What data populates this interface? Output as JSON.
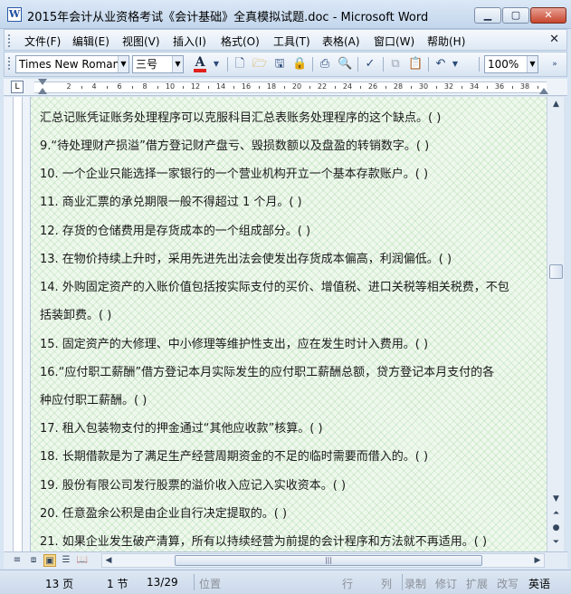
{
  "window": {
    "title": "2015年会计从业资格考试《会计基础》全真模拟试题.doc - Microsoft Word",
    "app_icon_letter": "W",
    "buttons": [
      "minimize-icon",
      "maximize-icon",
      "close-icon"
    ]
  },
  "menu": {
    "items": [
      "文件(F)",
      "编辑(E)",
      "视图(V)",
      "插入(I)",
      "格式(O)",
      "工具(T)",
      "表格(A)",
      "窗口(W)",
      "帮助(H)"
    ],
    "close_glyph": "✕"
  },
  "toolbar": {
    "font_name": "Times New Roman",
    "font_size": "三号",
    "font_color_letter": "A",
    "font_color": "#e0211c",
    "zoom": "100%"
  },
  "ruler": {
    "labels": [
      "2",
      "4",
      "6",
      "8",
      "10",
      "12",
      "14",
      "16",
      "18",
      "20",
      "22",
      "24",
      "26",
      "28",
      "30",
      "32",
      "34",
      "36",
      "38"
    ],
    "tab_selector": "L"
  },
  "document": {
    "lines": [
      "汇总记账凭证账务处理程序可以克服科目汇总表账务处理程序的这个缺点。(  )",
      "9.“待处理财产损溢”借方登记财产盘亏、毁损数额以及盘盈的转销数字。(  )",
      "10. 一个企业只能选择一家银行的一个营业机构开立一个基本存款账户。(  )",
      "11. 商业汇票的承兑期限一般不得超过 1 个月。(  )",
      "12. 存货的仓储费用是存货成本的一个组成部分。(  )",
      "13. 在物价持续上升时，采用先进先出法会使发出存货成本偏高，利润偏低。(  )",
      "14. 外购固定资产的入账价值包括按实际支付的买价、增值税、进口关税等相关税费，不包",
      "括装卸费。(  )",
      "15. 固定资产的大修理、中小修理等维护性支出，应在发生时计入费用。(  )",
      "16.“应付职工薪酬”借方登记本月实际发生的应付职工薪酬总额，贷方登记本月支付的各",
      "种应付职工薪酬。(  )",
      "17. 租入包装物支付的押金通过“其他应收款”核算。(  )",
      "18. 长期借款是为了满足生产经营周期资金的不足的临时需要而借入的。(  )",
      "19. 股份有限公司发行股票的溢价收入应记入实收资本。(  )",
      "20. 任意盈余公积是由企业自行决定提取的。(  )",
      "21. 如果企业发生破产清算，所有以持续经营为前提的会计程序和方法就不再适用。(  )"
    ]
  },
  "status": {
    "page": "13 页",
    "section": "1 节",
    "page_of": "13/29",
    "position_label": "位置",
    "line_label": "行",
    "col_label": "列",
    "rec": "录制",
    "trk": "修订",
    "ext": "扩展",
    "ovr": "改写",
    "lang": "英语"
  }
}
